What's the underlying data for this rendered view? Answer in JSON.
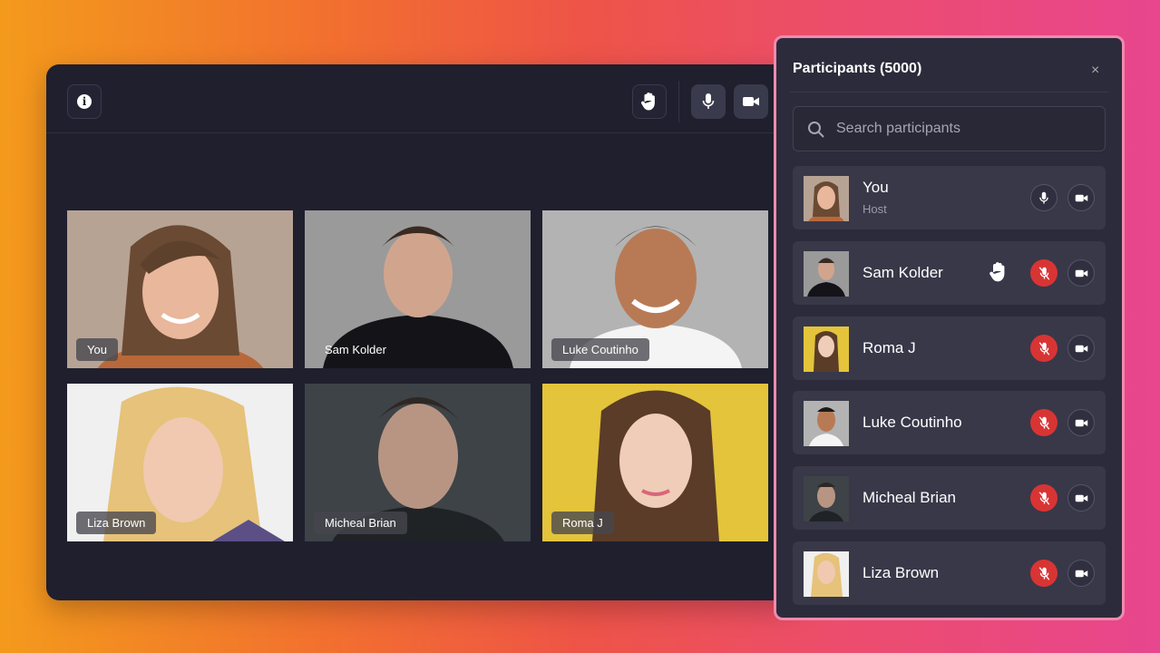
{
  "toolbar": {
    "info_icon": "info-icon",
    "hand_icon": "raise-hand-icon",
    "mic_icon": "microphone-icon",
    "cam_icon": "video-camera-icon"
  },
  "video_grid": [
    {
      "name": "You"
    },
    {
      "name": "Sam Kolder"
    },
    {
      "name": "Luke Coutinho"
    },
    {
      "name": "Liza Brown"
    },
    {
      "name": "Micheal Brian"
    },
    {
      "name": "Roma J"
    }
  ],
  "panel": {
    "title": "Participants (5000)",
    "close": "×",
    "search_placeholder": "Search participants",
    "participants": [
      {
        "name": "You",
        "role": "Host",
        "mic": "on",
        "hand_raised": false
      },
      {
        "name": "Sam Kolder",
        "role": "",
        "mic": "muted",
        "hand_raised": true
      },
      {
        "name": "Roma J",
        "role": "",
        "mic": "muted",
        "hand_raised": false
      },
      {
        "name": "Luke Coutinho",
        "role": "",
        "mic": "muted",
        "hand_raised": false
      },
      {
        "name": "Micheal Brian",
        "role": "",
        "mic": "muted",
        "hand_raised": false
      },
      {
        "name": "Liza Brown",
        "role": "",
        "mic": "muted",
        "hand_raised": false
      }
    ]
  },
  "colors": {
    "window_bg": "#1f1f2e",
    "panel_bg": "#2b2b3b",
    "row_bg": "#383849",
    "muted_red": "#d93434",
    "panel_border": "#f08aae"
  }
}
